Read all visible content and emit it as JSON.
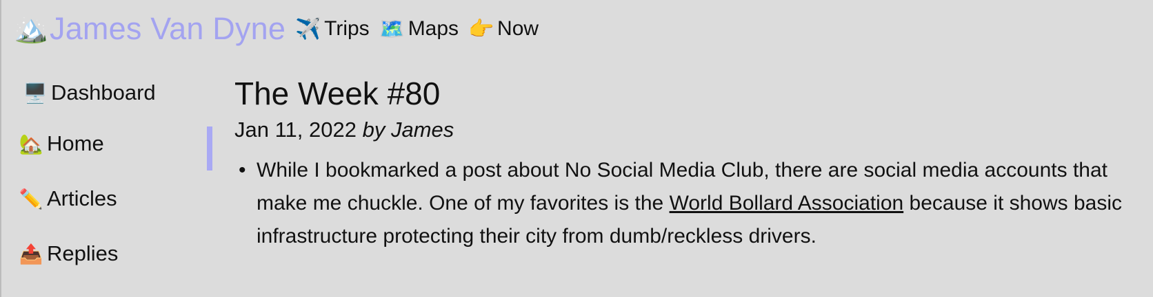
{
  "header": {
    "logo_icon": "🏔️",
    "site_title": "James Van Dyne",
    "nav": [
      {
        "icon": "✈️",
        "label": "Trips"
      },
      {
        "icon": "🗺️",
        "label": "Maps"
      },
      {
        "icon": "👉",
        "label": "Now"
      }
    ]
  },
  "sidebar": {
    "items": [
      {
        "icon": "🖥️",
        "label": "Dashboard"
      },
      {
        "icon": "🏡",
        "label": "Home"
      },
      {
        "icon": "✏️",
        "label": "Articles"
      },
      {
        "icon": "📤",
        "label": "Replies"
      }
    ],
    "active_item": "Home",
    "accent_color": "#a9a9f4"
  },
  "article": {
    "title": "The Week #80",
    "date": "Jan 11, 2022",
    "byline": "by James",
    "items": [
      {
        "text_before": "While I bookmarked a post about No Social Media Club, there are social media accounts that make me chuckle. One of my favorites is the ",
        "link_text": "World Bollard Association",
        "text_after": " because it shows basic infrastructure protecting their city from dumb/reckless drivers."
      }
    ]
  }
}
